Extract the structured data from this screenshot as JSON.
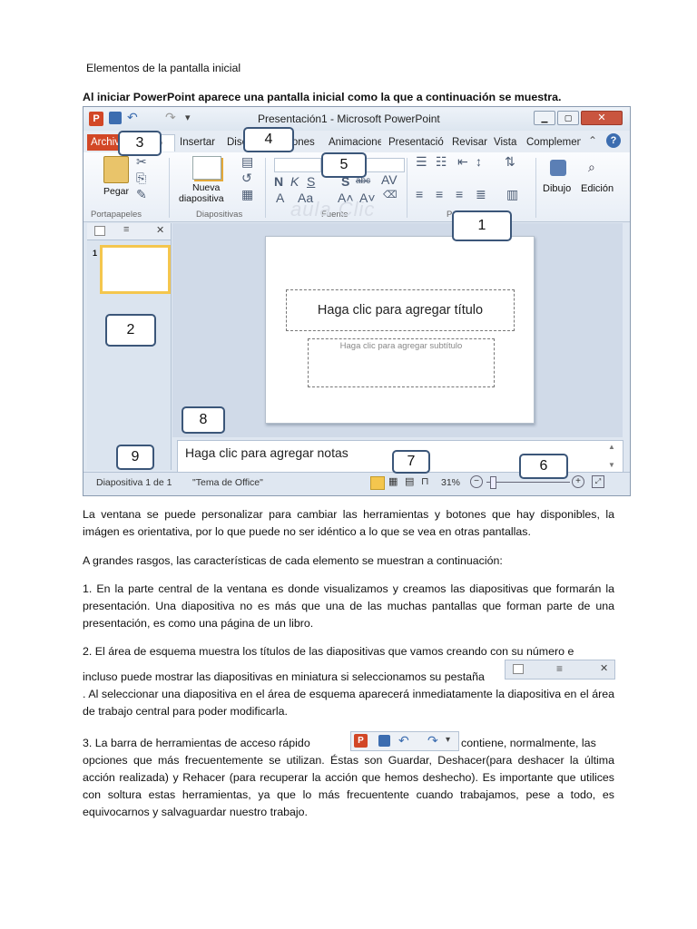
{
  "doc": {
    "heading": "Elementos de la pantalla inicial",
    "intro": "Al iniciar PowerPoint aparece una pantalla inicial como la que a continuación se muestra.",
    "para1": "La ventana se puede personalizar para cambiar las herramientas y botones que hay disponibles, la imágen es orientativa, por lo que puede no ser idéntico a lo que se vea en otras pantallas.",
    "para2": "A grandes rasgos, las características de cada elemento se muestran a continuación:",
    "item1": "1. En la parte central de la ventana es donde visualizamos y creamos las diapositivas que formarán la presentación. Una diapositiva no es más que una de las muchas pantallas que forman parte de una presentación, es como una página de un libro.",
    "item2a": "2. El área de esquema muestra los títulos de las diapositivas que vamos creando con su número e",
    "item2b": "incluso puede mostrar las diapositivas en miniatura si seleccionamos su pestaña",
    "item2c": ". Al seleccionar una diapositiva en el área de esquema aparecerá inmediatamente la diapositiva en el área de trabajo central para poder modificarla.",
    "item3a": "3. La barra de herramientas de acceso rápido",
    "item3b": "contiene, normalmente, las",
    "item3c": "opciones que más frecuentemente se utilizan. Éstas son Guardar, Deshacer(para deshacer la última acción realizada) y Rehacer (para recuperar la acción que hemos deshecho). Es importante que utilices con soltura estas herramientas, ya que lo más frecuentente cuando trabajamos, pese a todo, es equivocarnos y salvaguardar nuestro trabajo."
  },
  "screenshot": {
    "window_title": "Presentación1 - Microsoft PowerPoint",
    "tabs": [
      "Archivo",
      "Inicio",
      "Insertar",
      "Diseño",
      "Transiciones",
      "Animaciones",
      "Presentació",
      "Revisar",
      "Vista",
      "Complemen"
    ],
    "ribbon": {
      "paste": "Pegar",
      "new_slide_1": "Nueva",
      "new_slide_2": "diapositiva",
      "draw": "Dibujo",
      "edit": "Edición",
      "group_clipboard": "Portapapeles",
      "group_slides": "Diapositivas",
      "group_font": "Fuente",
      "group_paragraph": "P"
    },
    "slide_number": "1",
    "slide_title": "Haga clic para agregar título",
    "slide_subtitle": "Haga clic para agregar subtítulo",
    "notes_placeholder": "Haga clic para agregar notas",
    "status_slide": "Diapositiva 1 de 1",
    "status_theme": "\"Tema de Office\"",
    "zoom": "31%",
    "callouts": [
      "1",
      "2",
      "3",
      "4",
      "5",
      "6",
      "7",
      "8",
      "9"
    ],
    "watermark": "aula Clic"
  },
  "colors": {
    "accent": "#3b5679",
    "file_tab": "#d24726"
  }
}
